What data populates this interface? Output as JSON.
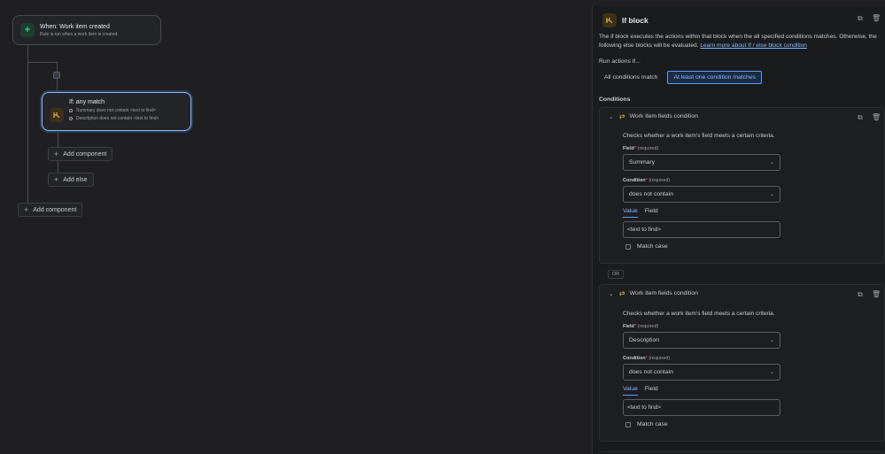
{
  "canvas": {
    "trigger": {
      "title": "When: Work item created",
      "subtitle": "Rule is run when a work item is created.",
      "icon": "plus-icon"
    },
    "if_card": {
      "title": "If: any match",
      "conditions": [
        "Summary does not contain <text to find>",
        "Description does not contain <text to find>"
      ],
      "icon": "branch-icon"
    },
    "inner_add_component": "Add component",
    "add_else": "Add else",
    "outer_add_component": "Add component"
  },
  "panel": {
    "title": "If block",
    "description": "The if block executes the actions within that block when the all specified conditions matches. Otherwise, the following else blocks will be evaluated.",
    "learn_more": "Learn more about If / else block condition",
    "run_actions_label": "Run actions if...",
    "options": [
      "All conditions match",
      "At least one condition matches"
    ],
    "selected_option": "At least one condition matches",
    "conditions_label": "Conditions",
    "or_label": "OR",
    "condition_cards": [
      {
        "name": "Work item fields condition",
        "description": "Checks whether a work item's field meets a certain criteria.",
        "field_label": "Field",
        "field_required": "(required)",
        "field_value": "Summary",
        "condition_label": "Condition",
        "condition_required": "(required)",
        "condition_value": "does not contain",
        "tabs": [
          "Value",
          "Field"
        ],
        "value_text": "<text to find>",
        "match_case": "Match case"
      },
      {
        "name": "Work item fields condition",
        "description": "Checks whether a work item's field meets a certain criteria.",
        "field_label": "Field",
        "field_required": "(required)",
        "field_value": "Description",
        "condition_label": "Condition",
        "condition_required": "(required)",
        "condition_value": "does not contain",
        "tabs": [
          "Value",
          "Field"
        ],
        "value_text": "<text to find>",
        "match_case": "Match case"
      }
    ]
  },
  "colors": {
    "background": "#1f1f21",
    "accent": "#579dff",
    "link": "#85b8ff",
    "trigger_icon": "#4cc38a",
    "branch_icon": "#e2b340"
  }
}
